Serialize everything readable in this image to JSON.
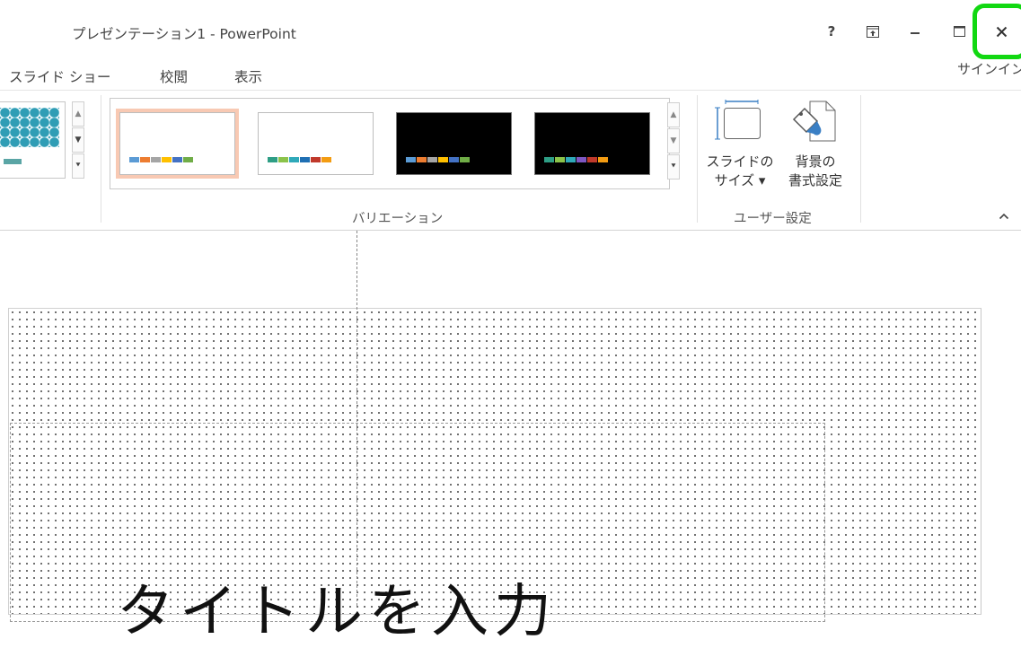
{
  "window": {
    "title": "プレゼンテーション1 - PowerPoint",
    "help": "?",
    "options_glyph": "⊼",
    "minimize_glyph": "–",
    "maximize_glyph": "☐",
    "close_glyph": "✕"
  },
  "tabs": [
    {
      "label": "スライド ショー"
    },
    {
      "label": "校閲"
    },
    {
      "label": "表示"
    }
  ],
  "signin": "サインイン",
  "ribbon": {
    "variations_label": "バリエーション",
    "user_settings_label": "ユーザー設定",
    "slide_size_line1": "スライドの",
    "slide_size_line2": "サイズ ▾",
    "format_bg_line1": "背景の",
    "format_bg_line2": "書式設定",
    "collapse_glyph": "^",
    "variations": [
      {
        "bg": "#ffffff",
        "selected": true,
        "colors": [
          "#5b9bd5",
          "#ed7d31",
          "#a5a5a5",
          "#ffc000",
          "#4472c4",
          "#70ad47"
        ]
      },
      {
        "bg": "#ffffff",
        "selected": false,
        "colors": [
          "#2e9e85",
          "#8bc34a",
          "#2fa9b9",
          "#1f6fb3",
          "#c0392b",
          "#f39c12"
        ]
      },
      {
        "bg": "#000000",
        "selected": false,
        "colors": [
          "#5b9bd5",
          "#ed7d31",
          "#a5a5a5",
          "#ffc000",
          "#4472c4",
          "#70ad47"
        ]
      },
      {
        "bg": "#000000",
        "selected": false,
        "colors": [
          "#2e9e85",
          "#8bc34a",
          "#2fa9b9",
          "#7e57c2",
          "#c0392b",
          "#f39c12"
        ]
      }
    ],
    "theme_accent": "#2f9db5"
  },
  "slide": {
    "title_placeholder": "タイトルを入力"
  },
  "colors": {
    "highlight": "#12d812",
    "selected_variation": "#f8c9b3"
  }
}
